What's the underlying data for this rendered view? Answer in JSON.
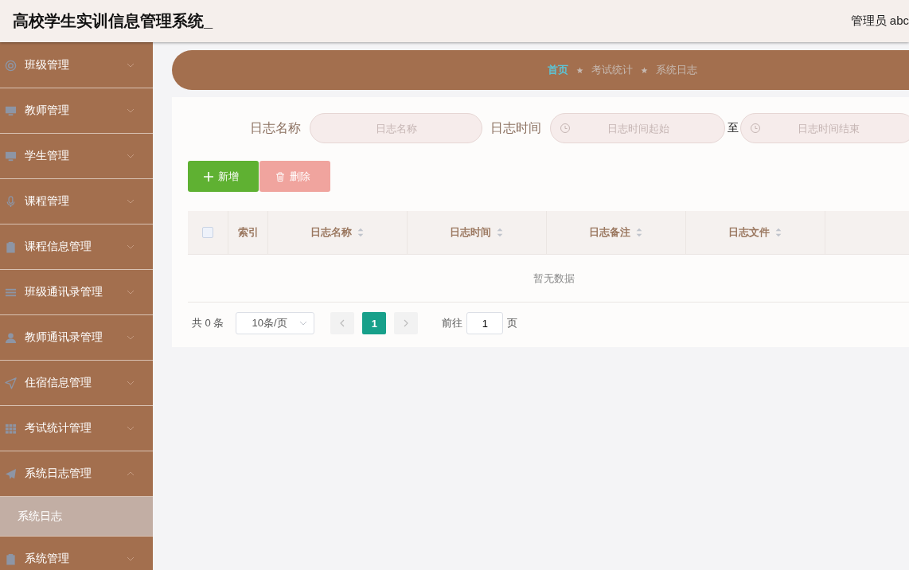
{
  "header": {
    "title": "高校学生实训信息管理系统_",
    "user": "管理员 abc"
  },
  "sidebar": {
    "items": [
      {
        "label": "班级管理",
        "expanded": false
      },
      {
        "label": "教师管理",
        "expanded": false
      },
      {
        "label": "学生管理",
        "expanded": false
      },
      {
        "label": "课程管理",
        "expanded": false
      },
      {
        "label": "课程信息管理",
        "expanded": false
      },
      {
        "label": "班级通讯录管理",
        "expanded": false
      },
      {
        "label": "教师通讯录管理",
        "expanded": false
      },
      {
        "label": "住宿信息管理",
        "expanded": false
      },
      {
        "label": "考试统计管理",
        "expanded": false
      },
      {
        "label": "系统日志管理",
        "expanded": true,
        "children": [
          {
            "label": "系统日志",
            "selected": true
          }
        ]
      },
      {
        "label": "系统管理",
        "expanded": false
      }
    ]
  },
  "breadcrumb": [
    {
      "label": "首页",
      "current": true
    },
    {
      "label": "考试统计",
      "current": false
    },
    {
      "label": "系统日志",
      "current": false
    }
  ],
  "search": {
    "name_label": "日志名称",
    "name_placeholder": "日志名称",
    "time_label": "日志时间",
    "start_placeholder": "日志时间起始",
    "separator": "至",
    "end_placeholder": "日志时间结束"
  },
  "actions": [
    {
      "label": "新增",
      "kind": "add",
      "disabled": false
    },
    {
      "label": "删除",
      "kind": "delete",
      "disabled": true
    }
  ],
  "table": {
    "checked": false,
    "columns": [
      {
        "label": "索引",
        "sortable": false
      },
      {
        "label": "日志名称",
        "sortable": true
      },
      {
        "label": "日志时间",
        "sortable": true
      },
      {
        "label": "日志备注",
        "sortable": true
      },
      {
        "label": "日志文件",
        "sortable": true
      }
    ],
    "empty_text": "暂无数据"
  },
  "pagination": {
    "total": "共 0 条",
    "page_size": "10条/页",
    "pages": [
      {
        "label": "1",
        "selected": true
      }
    ],
    "goto_label": "前往",
    "goto_value": "1",
    "goto_suffix": "页"
  }
}
